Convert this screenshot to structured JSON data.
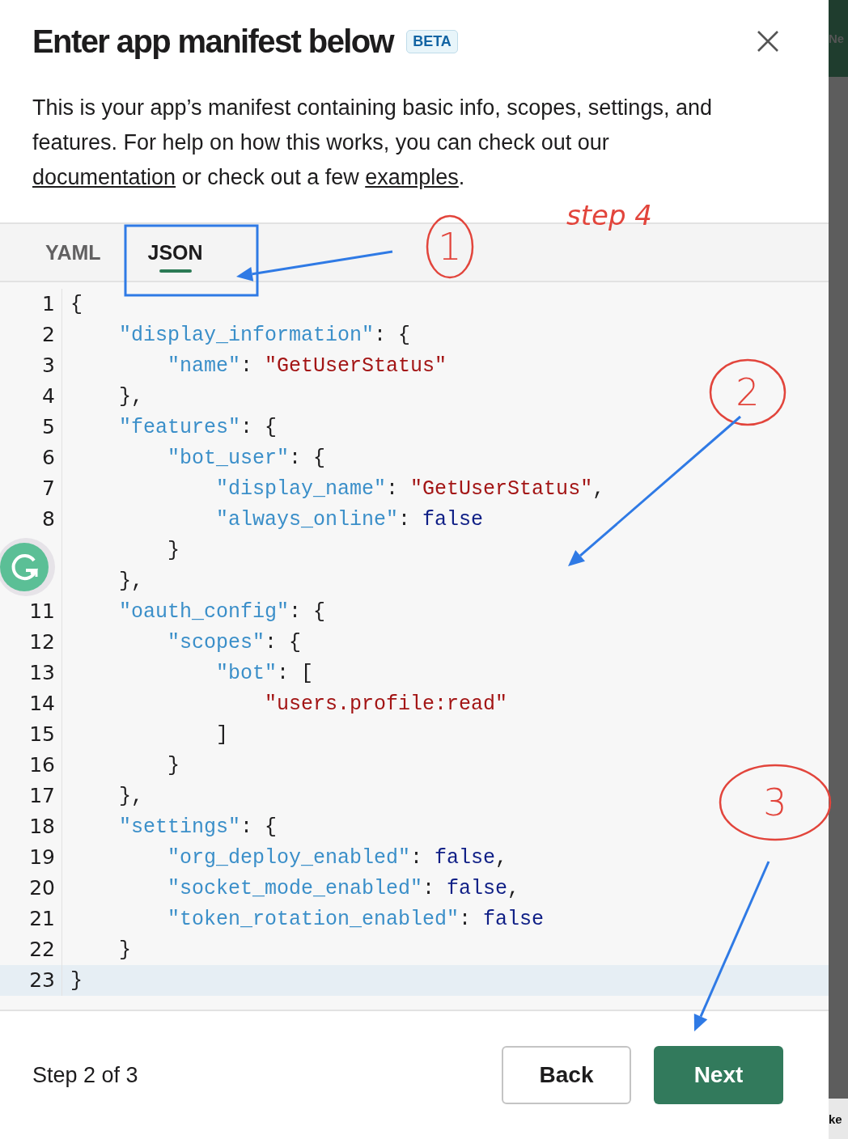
{
  "dialog": {
    "title": "Enter app manifest below",
    "badge": "BETA",
    "description": [
      {
        "kind": "text",
        "text": "This is your app’s manifest containing basic info, scopes, settings, and features. For help on how this works, you can check out our "
      },
      {
        "kind": "link",
        "text": "documentation"
      },
      {
        "kind": "text",
        "text": " or check out a few "
      },
      {
        "kind": "link",
        "text": "examples"
      },
      {
        "kind": "text",
        "text": "."
      }
    ],
    "tabs": [
      {
        "label": "YAML",
        "selected": false
      },
      {
        "label": "JSON",
        "selected": true
      }
    ],
    "editor": {
      "lines": [
        {
          "number": "1",
          "highlighted": false,
          "tokens": [
            {
              "kind": "punct",
              "text": "{"
            }
          ]
        },
        {
          "number": "2",
          "highlighted": false,
          "tokens": [
            {
              "kind": "key",
              "text": "    \"display_information\""
            },
            {
              "kind": "punct",
              "text": ": {"
            }
          ]
        },
        {
          "number": "3",
          "highlighted": false,
          "tokens": [
            {
              "kind": "key",
              "text": "        \"name\""
            },
            {
              "kind": "punct",
              "text": ": "
            },
            {
              "kind": "string",
              "text": "\"GetUserStatus\""
            }
          ]
        },
        {
          "number": "4",
          "highlighted": false,
          "tokens": [
            {
              "kind": "punct",
              "text": "    },"
            }
          ]
        },
        {
          "number": "5",
          "highlighted": false,
          "tokens": [
            {
              "kind": "key",
              "text": "    \"features\""
            },
            {
              "kind": "punct",
              "text": ": {"
            }
          ]
        },
        {
          "number": "6",
          "highlighted": false,
          "tokens": [
            {
              "kind": "key",
              "text": "        \"bot_user\""
            },
            {
              "kind": "punct",
              "text": ": {"
            }
          ]
        },
        {
          "number": "7",
          "highlighted": false,
          "tokens": [
            {
              "kind": "key",
              "text": "            \"display_name\""
            },
            {
              "kind": "punct",
              "text": ": "
            },
            {
              "kind": "string",
              "text": "\"GetUserStatus\""
            },
            {
              "kind": "punct",
              "text": ","
            }
          ]
        },
        {
          "number": "8",
          "highlighted": false,
          "tokens": [
            {
              "kind": "key",
              "text": "            \"always_online\""
            },
            {
              "kind": "punct",
              "text": ": "
            },
            {
              "kind": "literal",
              "text": "false"
            }
          ]
        },
        {
          "highlighted": false,
          "tokens": [
            {
              "kind": "punct",
              "text": "        }"
            }
          ]
        },
        {
          "highlighted": false,
          "tokens": [
            {
              "kind": "punct",
              "text": "    },"
            }
          ]
        },
        {
          "number": "11",
          "highlighted": false,
          "tokens": [
            {
              "kind": "key",
              "text": "    \"oauth_config\""
            },
            {
              "kind": "punct",
              "text": ": {"
            }
          ]
        },
        {
          "number": "12",
          "highlighted": false,
          "tokens": [
            {
              "kind": "key",
              "text": "        \"scopes\""
            },
            {
              "kind": "punct",
              "text": ": {"
            }
          ]
        },
        {
          "number": "13",
          "highlighted": false,
          "tokens": [
            {
              "kind": "key",
              "text": "            \"bot\""
            },
            {
              "kind": "punct",
              "text": ": ["
            }
          ]
        },
        {
          "number": "14",
          "highlighted": false,
          "tokens": [
            {
              "kind": "string",
              "text": "                \"users.profile:read\""
            }
          ]
        },
        {
          "number": "15",
          "highlighted": false,
          "tokens": [
            {
              "kind": "punct",
              "text": "            ]"
            }
          ]
        },
        {
          "number": "16",
          "highlighted": false,
          "tokens": [
            {
              "kind": "punct",
              "text": "        }"
            }
          ]
        },
        {
          "number": "17",
          "highlighted": false,
          "tokens": [
            {
              "kind": "punct",
              "text": "    },"
            }
          ]
        },
        {
          "number": "18",
          "highlighted": false,
          "tokens": [
            {
              "kind": "key",
              "text": "    \"settings\""
            },
            {
              "kind": "punct",
              "text": ": {"
            }
          ]
        },
        {
          "number": "19",
          "highlighted": false,
          "tokens": [
            {
              "kind": "key",
              "text": "        \"org_deploy_enabled\""
            },
            {
              "kind": "punct",
              "text": ": "
            },
            {
              "kind": "literal",
              "text": "false"
            },
            {
              "kind": "punct",
              "text": ","
            }
          ]
        },
        {
          "number": "20",
          "highlighted": false,
          "tokens": [
            {
              "kind": "key",
              "text": "        \"socket_mode_enabled\""
            },
            {
              "kind": "punct",
              "text": ": "
            },
            {
              "kind": "literal",
              "text": "false"
            },
            {
              "kind": "punct",
              "text": ","
            }
          ]
        },
        {
          "number": "21",
          "highlighted": false,
          "tokens": [
            {
              "kind": "key",
              "text": "        \"token_rotation_enabled\""
            },
            {
              "kind": "punct",
              "text": ": "
            },
            {
              "kind": "literal",
              "text": "false"
            }
          ]
        },
        {
          "number": "22",
          "highlighted": false,
          "tokens": [
            {
              "kind": "punct",
              "text": "    }"
            }
          ]
        },
        {
          "number": "23",
          "highlighted": true,
          "tokens": [
            {
              "kind": "punct",
              "text": "}"
            }
          ]
        }
      ]
    },
    "footer": {
      "step": "Step 2 of 3",
      "buttons": [
        {
          "label": "Back",
          "kind": "secondary"
        },
        {
          "label": "Next",
          "kind": "primary"
        }
      ]
    }
  },
  "background_page": {
    "texts": [
      "Ne",
      "ke"
    ]
  },
  "annotations": [
    {
      "kind": "note",
      "text": "step 4"
    },
    {
      "kind": "box"
    },
    {
      "kind": "arrow"
    },
    {
      "kind": "circled",
      "text": "1"
    },
    {
      "kind": "circled",
      "text": "2"
    },
    {
      "kind": "arrow"
    },
    {
      "kind": "circled",
      "text": "3"
    },
    {
      "kind": "arrow"
    }
  ]
}
